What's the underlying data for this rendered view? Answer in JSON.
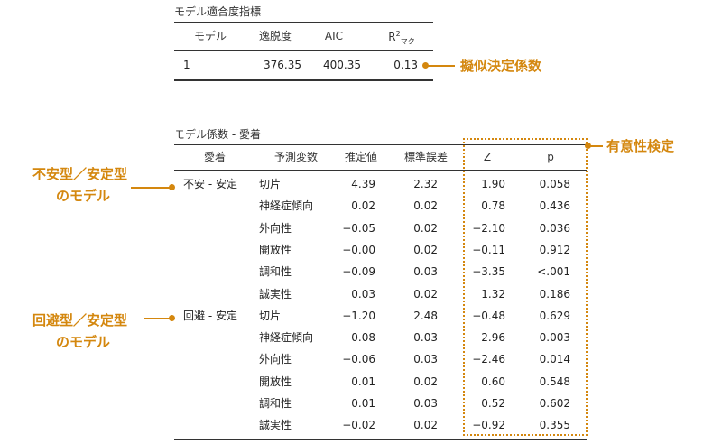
{
  "fit_table": {
    "caption": "モデル適合度指標",
    "headers": [
      "モデル",
      "逸脱度",
      "AIC",
      "R²マク"
    ],
    "row": [
      "1",
      "376.35",
      "400.35",
      "0.13"
    ]
  },
  "coef_table": {
    "caption": "モデル係数 - 愛着",
    "headers": [
      "愛着",
      "予測変数",
      "推定値",
      "標準誤差",
      "Z",
      "p"
    ],
    "groups": [
      {
        "label": "不安 - 安定",
        "rows": [
          [
            "切片",
            "4.39",
            "2.32",
            "1.90",
            "0.058"
          ],
          [
            "神経症傾向",
            "0.02",
            "0.02",
            "0.78",
            "0.436"
          ],
          [
            "外向性",
            "−0.05",
            "0.02",
            "−2.10",
            "0.036"
          ],
          [
            "開放性",
            "−0.00",
            "0.02",
            "−0.11",
            "0.912"
          ],
          [
            "調和性",
            "−0.09",
            "0.03",
            "−3.35",
            "<.001"
          ],
          [
            "誠実性",
            "0.03",
            "0.02",
            "1.32",
            "0.186"
          ]
        ]
      },
      {
        "label": "回避 - 安定",
        "rows": [
          [
            "切片",
            "−1.20",
            "2.48",
            "−0.48",
            "0.629"
          ],
          [
            "神経症傾向",
            "0.08",
            "0.03",
            "2.96",
            "0.003"
          ],
          [
            "外向性",
            "−0.06",
            "0.03",
            "−2.46",
            "0.014"
          ],
          [
            "開放性",
            "0.01",
            "0.02",
            "0.60",
            "0.548"
          ],
          [
            "調和性",
            "0.01",
            "0.03",
            "0.52",
            "0.602"
          ],
          [
            "誠実性",
            "−0.02",
            "0.02",
            "−0.92",
            "0.355"
          ]
        ]
      }
    ]
  },
  "annotations": {
    "pseudo_r2": "擬似決定係数",
    "significance": "有意性検定",
    "anxious_line1": "不安型／安定型",
    "anxious_line2": "のモデル",
    "avoidant_line1": "回避型／安定型",
    "avoidant_line2": "のモデル"
  },
  "colors": {
    "accent": "#D4870E",
    "text": "#222222",
    "rule": "#333333"
  }
}
